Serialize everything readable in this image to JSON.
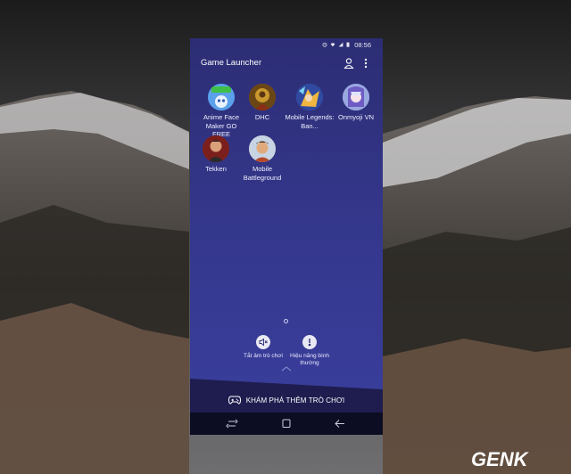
{
  "status_bar": {
    "time": "08:56",
    "icons": [
      "alarm-icon",
      "wifi-icon",
      "signal-icon",
      "battery-icon"
    ]
  },
  "header": {
    "title": "Game Launcher",
    "icons": [
      "profile-icon",
      "more-vert-icon"
    ]
  },
  "apps": [
    {
      "label": "Anime Face Maker GO FREE",
      "icon": "anime-face-maker-icon",
      "color": "#3e7bd6"
    },
    {
      "label": "DHC",
      "icon": "dhc-icon",
      "color": "#a8731e"
    },
    {
      "label": "Mobile Legends: Ban...",
      "icon": "mobile-legends-icon",
      "color": "#3d5fb8"
    },
    {
      "label": "Onmyoji VN",
      "icon": "onmyoji-icon",
      "color": "#8ea0d8"
    },
    {
      "label": "Tekken",
      "icon": "tekken-icon",
      "color": "#9b2f2a"
    },
    {
      "label": "Mobile Battleground",
      "icon": "mobile-battleground-icon",
      "color": "#c98b52"
    }
  ],
  "quick_actions": [
    {
      "label": "Tắt âm trò chơi",
      "icon": "mute-icon"
    },
    {
      "label": "Hiệu năng bình thường",
      "icon": "performance-icon"
    }
  ],
  "explore": {
    "label": "KHÁM PHÁ THÊM TRÒ CHƠI",
    "icon": "gamepad-icon"
  },
  "navigation": [
    "recents-icon",
    "home-icon",
    "back-icon"
  ],
  "watermark": {
    "text": "GENK"
  },
  "colors": {
    "accent": "#3a3f9e",
    "footer": "#23215a",
    "navbar": "#0c0c22"
  }
}
